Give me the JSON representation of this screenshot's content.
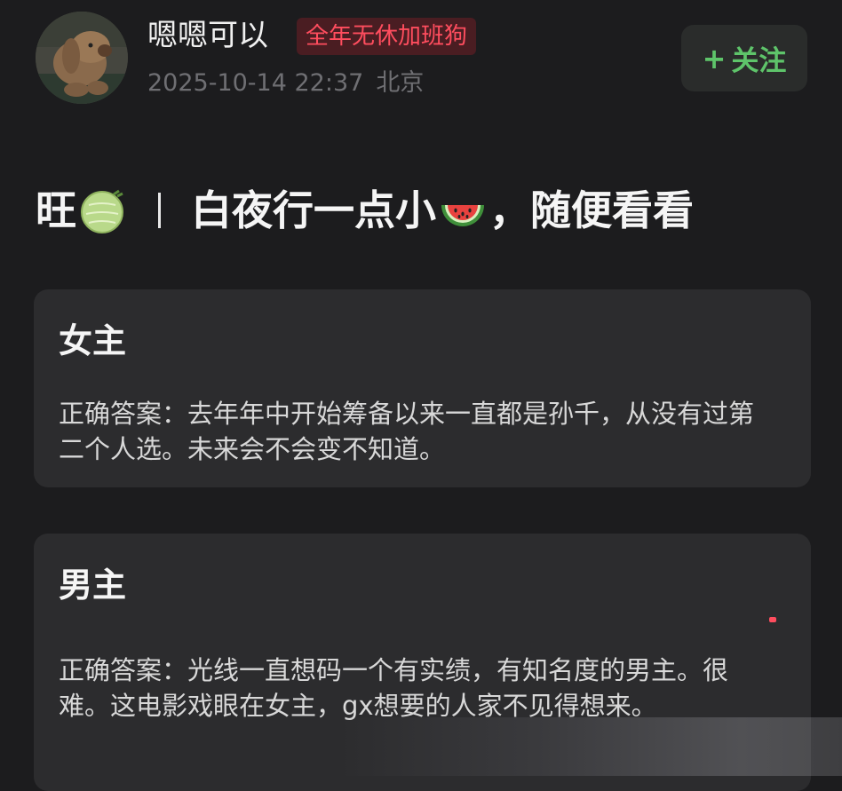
{
  "post": {
    "author": {
      "name": "嗯嗯可以",
      "badge": "全年无休加班狗",
      "avatar_icon": "plush-dog-avatar"
    },
    "meta": {
      "datetime": "2025-10-14 22:37",
      "location": "北京"
    },
    "follow_label": "关注",
    "follow_plus": "+",
    "title": {
      "part1": "旺",
      "part2": "白夜行一点小",
      "part3": "，随便看看",
      "emoji1": "melon-icon",
      "emoji2": "watermelon-icon"
    },
    "sections": [
      {
        "heading": "女主",
        "body": "正确答案：去年年中开始筹备以来一直都是孙千，从没有过第二个人选。未来会不会变不知道。"
      },
      {
        "heading": "男主",
        "body": "正确答案：光线一直想码一个有实绩，有知名度的男主。很难。这电影戏眼在女主，gx想要的人家不见得想来。"
      }
    ]
  },
  "colors": {
    "background": "#1c1c1e",
    "card": "#2c2c2e",
    "badge_text": "#ff4d5e",
    "follow_text": "#5ec46a",
    "meta_text": "#6f6f73"
  }
}
